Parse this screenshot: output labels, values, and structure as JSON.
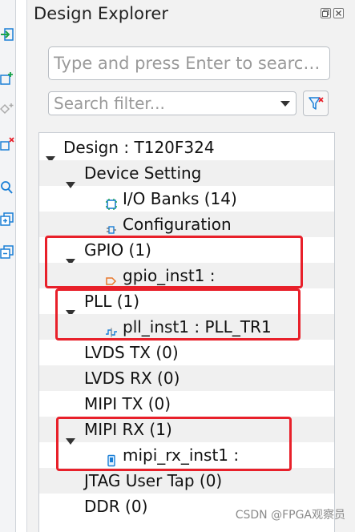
{
  "panel": {
    "title": "Design Explorer",
    "search": {
      "placeholder": "Type and press Enter to searc…"
    },
    "filter": {
      "placeholder": "Search filter..."
    }
  },
  "tree": {
    "rows": [
      {
        "label": "Design : T120F324",
        "icon": "",
        "expanded": true
      },
      {
        "label": "Device Setting",
        "icon": "",
        "expanded": true
      },
      {
        "label": "I/O Banks (14)",
        "icon": "io-bank-icon"
      },
      {
        "label": "Configuration",
        "icon": "configuration-icon"
      },
      {
        "label": "GPIO (1)",
        "icon": "",
        "expanded": true
      },
      {
        "label": "gpio_inst1 :",
        "icon": "gpio-instance-icon"
      },
      {
        "label": "PLL (1)",
        "icon": "",
        "expanded": true
      },
      {
        "label": "pll_inst1 : PLL_TR1",
        "icon": "pll-instance-icon"
      },
      {
        "label": "LVDS TX (0)",
        "icon": ""
      },
      {
        "label": "LVDS RX (0)",
        "icon": ""
      },
      {
        "label": "MIPI TX (0)",
        "icon": ""
      },
      {
        "label": "MIPI RX (1)",
        "icon": "",
        "expanded": true
      },
      {
        "label": "mipi_rx_inst1 :",
        "icon": "mipi-rx-instance-icon"
      },
      {
        "label": "JTAG User Tap (0)",
        "icon": ""
      },
      {
        "label": "DDR (0)",
        "icon": ""
      }
    ]
  },
  "watermark": "CSDN @FPGA观察员",
  "colors": {
    "highlight": "#e8202a",
    "accent": "#1a7fd6"
  }
}
